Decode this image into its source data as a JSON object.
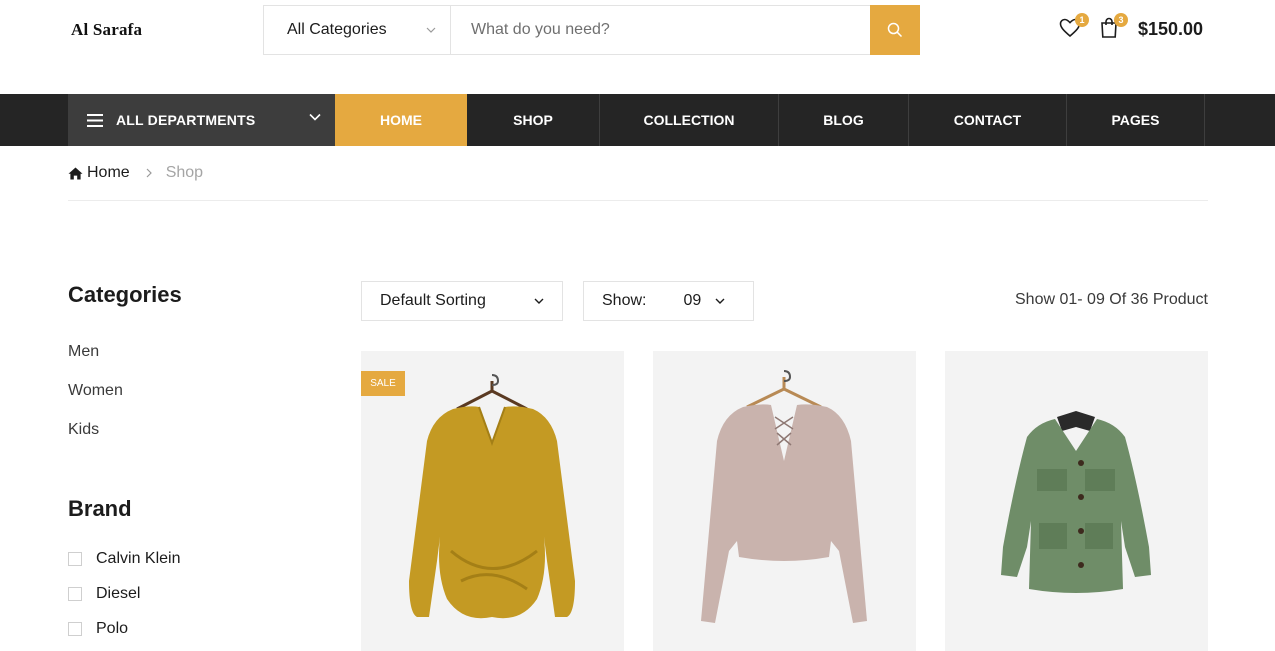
{
  "header": {
    "logo": "Al Sarafa",
    "category_select": "All Categories",
    "search_placeholder": "What do you need?",
    "wishlist_count": "1",
    "cart_count": "3",
    "cart_total": "$150.00"
  },
  "nav": {
    "departments": "ALL DEPARTMENTS",
    "items": [
      "HOME",
      "SHOP",
      "COLLECTION",
      "BLOG",
      "CONTACT",
      "PAGES"
    ],
    "active": "HOME"
  },
  "breadcrumb": {
    "home": "Home",
    "current": "Shop"
  },
  "sidebar": {
    "categories_title": "Categories",
    "categories": [
      "Men",
      "Women",
      "Kids"
    ],
    "brand_title": "Brand",
    "brands": [
      "Calvin Klein",
      "Diesel",
      "Polo"
    ]
  },
  "toolbar": {
    "sorting": "Default Sorting",
    "show_label": "Show:",
    "show_value": "09",
    "result_text": "Show 01- 09 Of 36 Product"
  },
  "products": [
    {
      "badge": "SALE",
      "image": "mustard-twist-sweater",
      "color": "#c49a23"
    },
    {
      "badge": "",
      "image": "pink-lace-up-sweater",
      "color": "#c9b3ad"
    },
    {
      "badge": "",
      "image": "green-utility-jacket",
      "color": "#6f8d68"
    }
  ],
  "colors": {
    "accent": "#e5a940",
    "nav_bg": "#252525",
    "dept_bg": "#3d3d3d"
  }
}
